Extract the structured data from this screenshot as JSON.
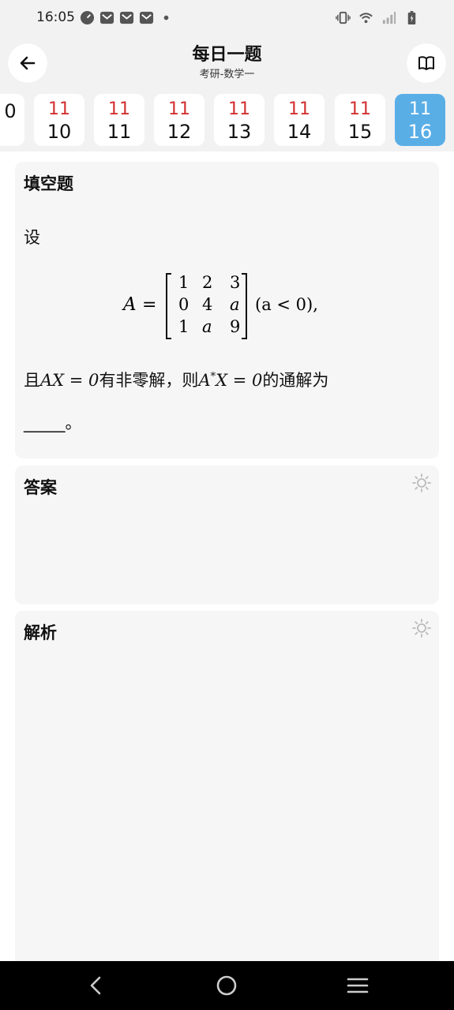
{
  "status_bar": {
    "time": "16:05",
    "left_icons": [
      "speedometer-icon",
      "mail-icon",
      "mail-icon",
      "mail-icon",
      "dot-icon"
    ],
    "right_icons": [
      "vibrate-icon",
      "wifi-icon",
      "signal-icon",
      "battery-icon"
    ]
  },
  "header": {
    "title": "每日一题",
    "subtitle": "考研-数学一",
    "back_icon": "arrow-left-icon",
    "book_icon": "book-open-icon"
  },
  "dates": [
    {
      "month": "",
      "day": "0",
      "active": false
    },
    {
      "month": "11",
      "day": "10",
      "active": false
    },
    {
      "month": "11",
      "day": "11",
      "active": false
    },
    {
      "month": "11",
      "day": "12",
      "active": false
    },
    {
      "month": "11",
      "day": "13",
      "active": false
    },
    {
      "month": "11",
      "day": "14",
      "active": false
    },
    {
      "month": "11",
      "day": "15",
      "active": false
    },
    {
      "month": "11",
      "day": "16",
      "active": true
    }
  ],
  "question": {
    "type_label": "填空题",
    "intro": "设",
    "matrix_lhs": "A",
    "equals": "=",
    "matrix_rows": [
      [
        "1",
        "2",
        "3"
      ],
      [
        "0",
        "4",
        "a"
      ],
      [
        "1",
        "a",
        "9"
      ]
    ],
    "condition": "(a < 0),",
    "line2_prefix": "且",
    "line2_eq1": "AX = 0",
    "line2_mid": "有非零解，则",
    "line2_eq2_a": "A",
    "line2_eq2_sup": "*",
    "line2_eq2_b": "X = 0",
    "line2_suffix": "的通解为",
    "blank": "_____。"
  },
  "answer": {
    "title": "答案",
    "icon": "sun-icon"
  },
  "analysis": {
    "title": "解析",
    "icon": "sun-icon"
  },
  "nav": {
    "back": "back-chevron-icon",
    "home": "home-circle-icon",
    "recents": "menu-lines-icon"
  },
  "colors": {
    "accent": "#5aaee6",
    "month_red": "#d32f2f",
    "card_bg": "#f6f6f6",
    "header_bg": "#f2f2f2"
  }
}
